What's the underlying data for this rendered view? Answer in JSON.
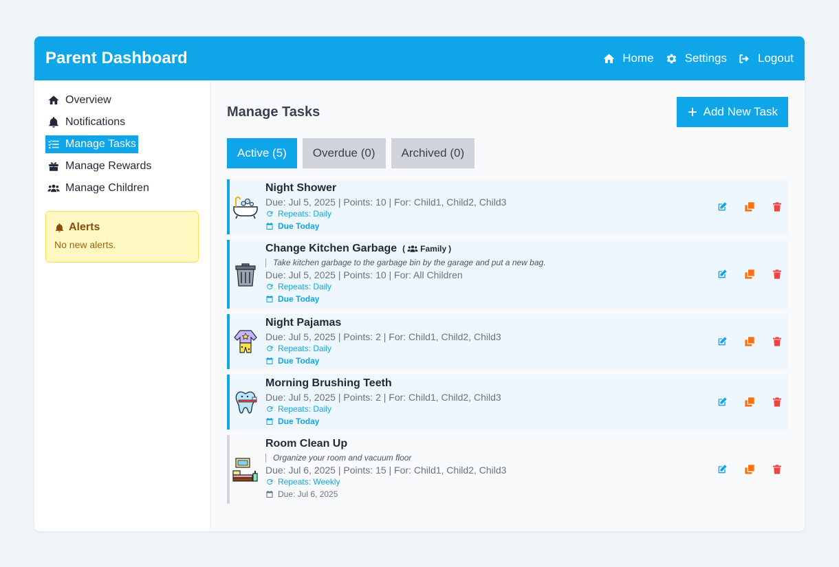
{
  "header": {
    "title": "Parent Dashboard",
    "nav": [
      {
        "label": "Home",
        "icon": "home-icon"
      },
      {
        "label": "Settings",
        "icon": "gear-icon"
      },
      {
        "label": "Logout",
        "icon": "logout-icon"
      }
    ]
  },
  "sidebar": {
    "items": [
      {
        "label": "Overview",
        "icon": "home-icon"
      },
      {
        "label": "Notifications",
        "icon": "bell-icon"
      },
      {
        "label": "Manage Tasks",
        "icon": "task-list-icon",
        "active": true
      },
      {
        "label": "Manage Rewards",
        "icon": "gift-icon"
      },
      {
        "label": "Manage Children",
        "icon": "users-icon"
      }
    ],
    "alerts": {
      "title": "Alerts",
      "message": "No new alerts."
    }
  },
  "main": {
    "title": "Manage Tasks",
    "add_button": "Add New Task",
    "tabs": [
      {
        "label": "Active (5)",
        "active": true
      },
      {
        "label": "Overdue (0)"
      },
      {
        "label": "Archived (0)"
      }
    ],
    "tasks": [
      {
        "title": "Night Shower",
        "badge": "",
        "description": "",
        "meta": "Due: Jul 5, 2025 | Points: 10 | For: Child1, Child2, Child3",
        "repeat": "Repeats: Daily",
        "due": "Due Today",
        "icon": "bathtub-icon"
      },
      {
        "title": "Change Kitchen Garbage",
        "badge": "Family",
        "description": "Take kitchen garbage to the garbage bin by the garage and put a new bag.",
        "meta": "Due: Jul 5, 2025 | Points: 10 | For: All Children",
        "repeat": "Repeats: Daily",
        "due": "Due Today",
        "icon": "trash-can-icon"
      },
      {
        "title": "Night Pajamas",
        "badge": "",
        "description": "",
        "meta": "Due: Jul 5, 2025 | Points: 2 | For: Child1, Child2, Child3",
        "repeat": "Repeats: Daily",
        "due": "Due Today",
        "icon": "pajamas-icon"
      },
      {
        "title": "Morning Brushing Teeth",
        "badge": "",
        "description": "",
        "meta": "Due: Jul 5, 2025 | Points: 2 | For: Child1, Child2, Child3",
        "repeat": "Repeats: Daily",
        "due": "Due Today",
        "icon": "tooth-icon"
      },
      {
        "title": "Room Clean Up",
        "badge": "",
        "description": "Organize your room and vacuum floor",
        "meta": "Due: Jul 6, 2025 | Points: 15 | For: Child1, Child2, Child3",
        "repeat": "Repeats: Weekly",
        "due": "Due: Jul 6, 2025",
        "icon": "room-icon",
        "inactive": true
      }
    ]
  },
  "colors": {
    "accent": "#0ea5e9",
    "edit": "#0ea5e9",
    "copy": "#f97316",
    "delete": "#ef4444",
    "alert_bg": "#fef9c3",
    "alert_text": "#854d0e"
  }
}
